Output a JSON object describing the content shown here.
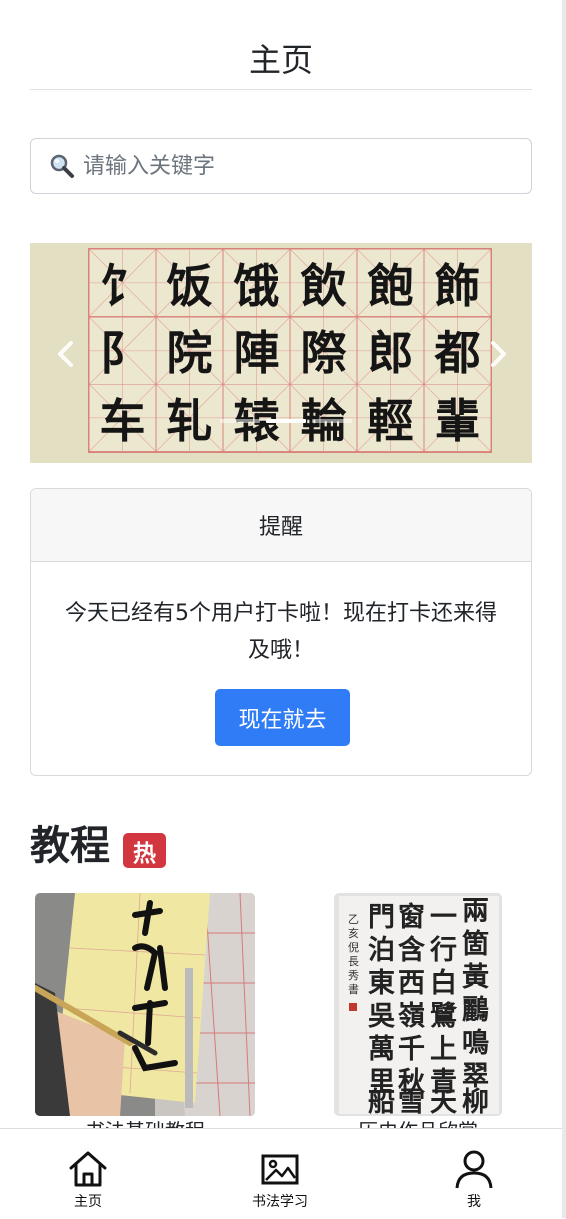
{
  "header": {
    "title": "主页"
  },
  "search": {
    "placeholder": "请输入关键字",
    "icon": "magnifier-icon"
  },
  "carousel": {
    "characters": [
      [
        "饣",
        "饭",
        "饿",
        "飲",
        "飽",
        "飾"
      ],
      [
        "阝",
        "院",
        "陣",
        "際",
        "郎",
        "都"
      ],
      [
        "车",
        "轧",
        "辕",
        "輪",
        "輕",
        "輩"
      ]
    ],
    "slide_count": 3,
    "active_slide": 2,
    "prev_icon": "chevron-left-icon",
    "next_icon": "chevron-right-icon"
  },
  "reminder": {
    "title": "提醒",
    "message": "今天已经有5个用户打卡啦！现在打卡还来得及哦！",
    "button": "现在就去"
  },
  "tutorials": {
    "title": "教程",
    "badge": "热",
    "items": [
      {
        "caption": "书法基础教程",
        "image": "brush-writing-photo"
      },
      {
        "caption": "历史作品欣赏",
        "image": "calligraphy-scroll-photo"
      }
    ]
  },
  "tabbar": {
    "items": [
      {
        "label": "主页",
        "icon": "home-icon"
      },
      {
        "label": "书法学习",
        "icon": "image-icon"
      },
      {
        "label": "我",
        "icon": "user-icon"
      }
    ]
  },
  "colors": {
    "primary_button": "#2f7cf6",
    "hot_badge": "#d2373f",
    "carousel_background": "#e3dfc3",
    "grid_line": "#d9827b"
  }
}
